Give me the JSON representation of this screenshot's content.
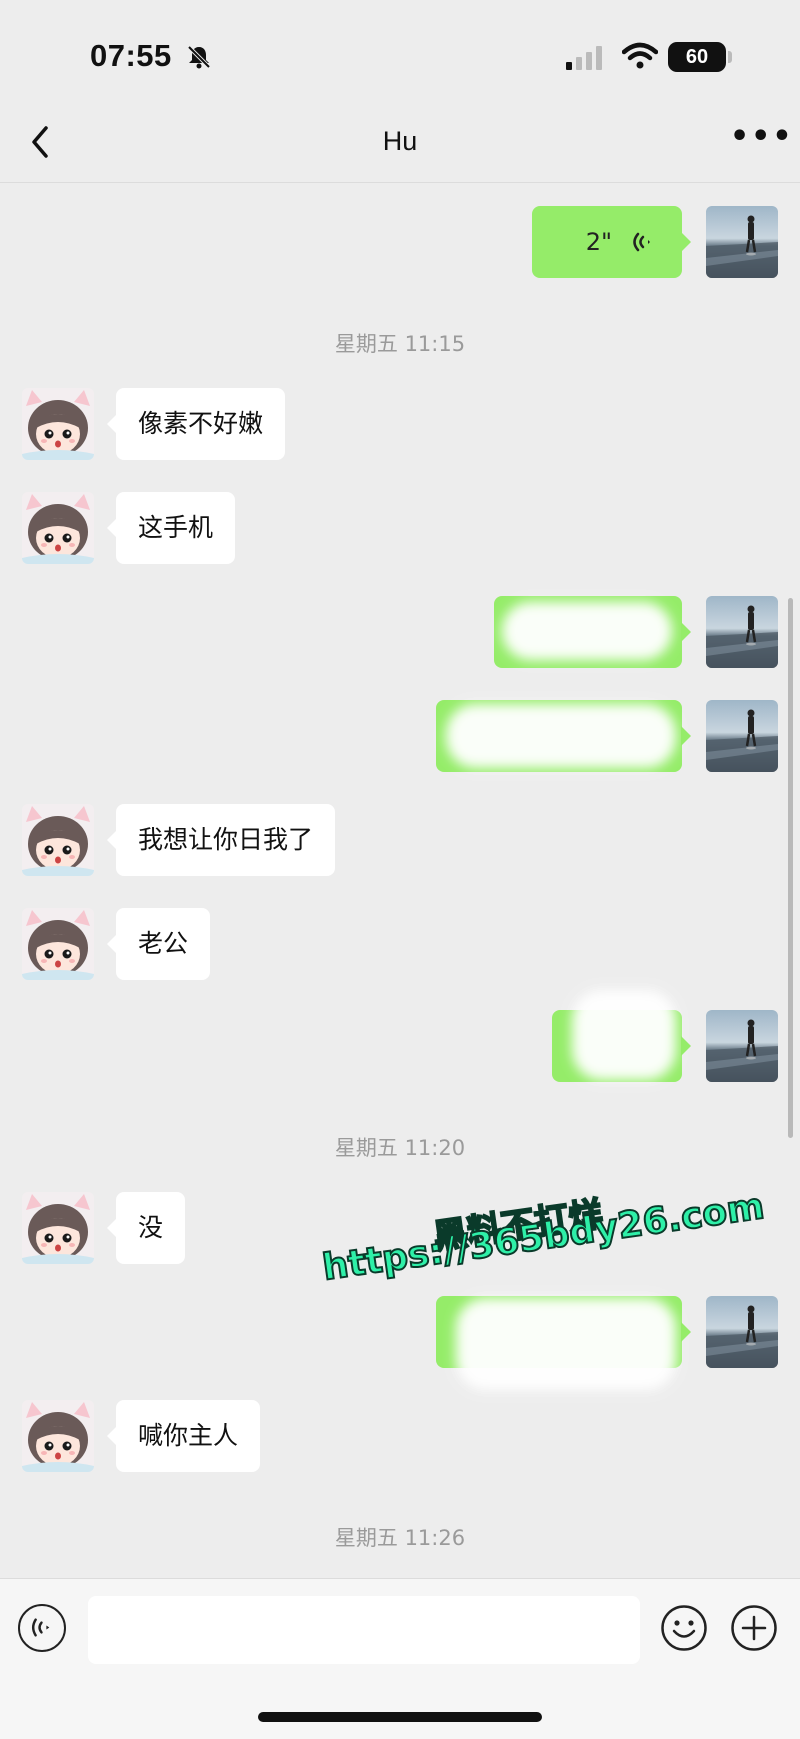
{
  "status_bar": {
    "time": "07:55",
    "battery": "60"
  },
  "header": {
    "title": "Hu"
  },
  "timestamps": [
    "星期五 11:15",
    "星期五 11:20",
    "星期五 11:26"
  ],
  "voice_message": {
    "duration": "2\""
  },
  "messages": {
    "m1": "像素不好嫩",
    "m2": "这手机",
    "m3": "我想让你日我了",
    "m4": "老公",
    "m5": "没",
    "m6": "喊你主人"
  },
  "watermark": {
    "line1": "黑料不打烊",
    "line2": "https://365bdy26.com"
  },
  "colors": {
    "background": "#ededed",
    "sent_bubble": "#95ec69",
    "received_bubble": "#ffffff",
    "watermark": "#2ef0a8"
  },
  "icons": [
    "silent-bell-icon",
    "signal-icon",
    "wifi-icon",
    "back-chevron-icon",
    "more-icon",
    "voice-wave-icon",
    "voice-input-icon",
    "emoji-icon",
    "plus-icon"
  ]
}
